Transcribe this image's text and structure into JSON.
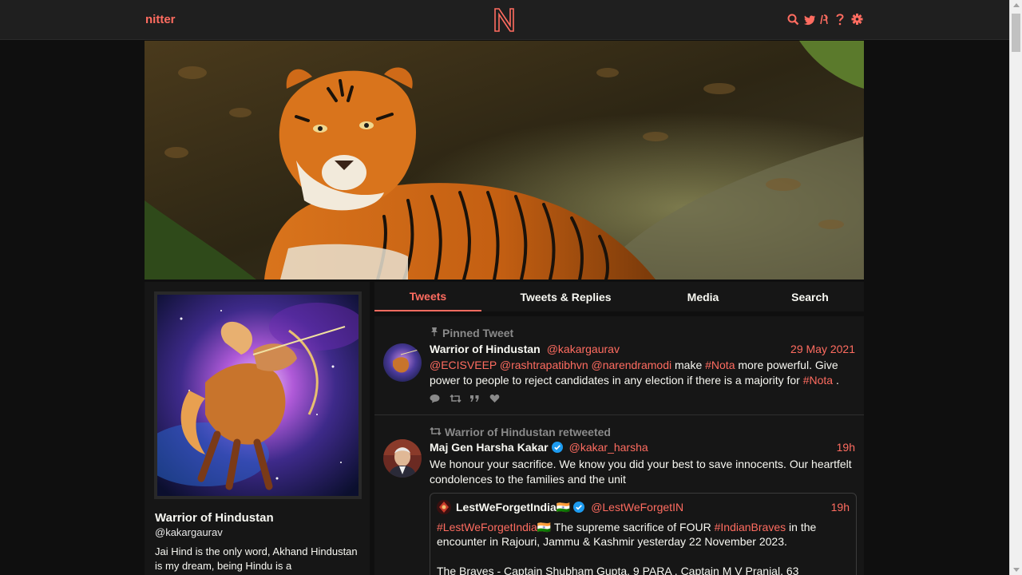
{
  "navbar": {
    "logo_text": "nitter",
    "icons": [
      "search-icon",
      "twitter-bird-icon",
      "rss-icon",
      "help-icon",
      "settings-gear-icon"
    ]
  },
  "profile": {
    "name": "Warrior of Hindustan",
    "handle": "@kakargaurav",
    "bio": "Jai Hind is the only word, Akhand Hindustan is my dream, being Hindu is a"
  },
  "tabs": [
    {
      "label": "Tweets",
      "active": true
    },
    {
      "label": "Tweets & Replies",
      "active": false
    },
    {
      "label": "Media",
      "active": false
    },
    {
      "label": "Search",
      "active": false
    }
  ],
  "tweets": {
    "pinned": {
      "pinned_label": "Pinned Tweet",
      "fullname": "Warrior of Hindustan",
      "username": "@kakargaurav",
      "date": "29 May 2021",
      "mentions": [
        "@ECISVEEP",
        "@rashtrapatibhvn",
        "@narendramodi"
      ],
      "text_make": " make ",
      "hashtag1": "#Nota",
      "text_rest": " more powerful. Give power to people to reject candidates in any election if there is a majority for ",
      "hashtag2": "#Nota",
      "text_end": " ."
    },
    "retweet": {
      "retweet_label": "Warrior of Hindustan retweeted",
      "fullname": "Maj Gen Harsha Kakar",
      "username": "@kakar_harsha",
      "date": "19h",
      "text": "We honour your sacrifice. We know you did your best to save innocents. Our heartfelt condolences to the families and the unit",
      "quote": {
        "fullname": "LestWeForgetIndia🇮🇳",
        "username": "@LestWeForgetIN",
        "date": "19h",
        "hashtag1": "#LestWeForgetIndia🇮🇳",
        "text1": " The supreme sacrifice of FOUR ",
        "hashtag2": "#IndianBraves",
        "text2": " in the encounter in Rajouri, Jammu & Kashmir yesterday 22 November 2023.",
        "text3": "The Braves - Captain Shubham Gupta, 9 PARA , Captain M V Pranjal, 63"
      }
    }
  },
  "colors": {
    "accent": "#ff6c60",
    "background": "#0f0f0f",
    "panel": "#161616",
    "navbar": "#1f1f1f"
  }
}
